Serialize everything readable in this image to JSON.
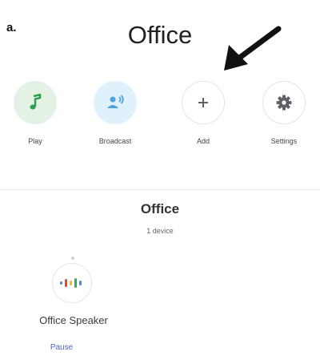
{
  "figure": {
    "panel_label": "a."
  },
  "header": {
    "room_title": "Office"
  },
  "actions": [
    {
      "label": "Play",
      "icon": "music-note-icon",
      "color": "#2e9f4c"
    },
    {
      "label": "Broadcast",
      "icon": "broadcast-icon",
      "color": "#4aa3df"
    },
    {
      "label": "Add",
      "icon": "plus-icon",
      "color": "#5f6368"
    },
    {
      "label": "Settings",
      "icon": "gear-icon",
      "color": "#5f6368"
    }
  ],
  "group": {
    "title": "Office",
    "count_text": "1 device"
  },
  "devices": [
    {
      "name": "Office Speaker",
      "action_label": "Pause",
      "icon": "speaker-dots-icon"
    }
  ],
  "colors": {
    "accent_link": "#4a67c9",
    "play_bg": "#e4f2e6",
    "broadcast_bg": "#dff1fb"
  }
}
